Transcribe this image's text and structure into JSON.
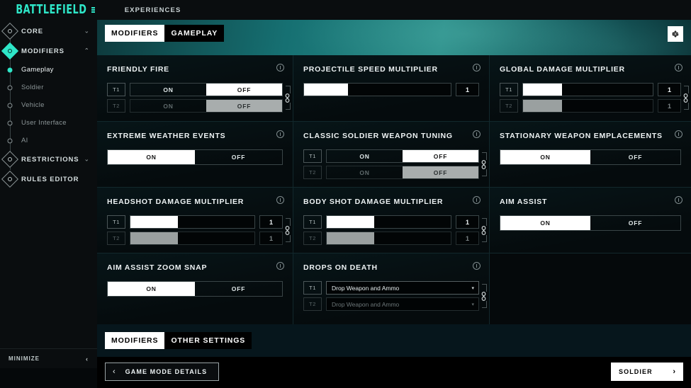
{
  "topbar": {
    "logo": "BATTLEFIELD",
    "nav": [
      {
        "label": "EXPERIENCES"
      }
    ]
  },
  "sidebar": {
    "items": [
      {
        "label": "CORE",
        "type": "section",
        "node": "diamond",
        "chevron": "⌄",
        "active": false
      },
      {
        "label": "MODIFIERS",
        "type": "section",
        "node": "diamond-filled",
        "chevron": "⌃",
        "active": true
      },
      {
        "label": "Gameplay",
        "type": "sub",
        "node": "dot-filled",
        "active": true
      },
      {
        "label": "Soldier",
        "type": "sub",
        "node": "dot",
        "active": false
      },
      {
        "label": "Vehicle",
        "type": "sub",
        "node": "dot",
        "active": false
      },
      {
        "label": "User Interface",
        "type": "sub",
        "node": "dot",
        "active": false
      },
      {
        "label": "AI",
        "type": "sub",
        "node": "dot",
        "active": false
      },
      {
        "label": "RESTRICTIONS",
        "type": "section",
        "node": "diamond",
        "chevron": "⌄",
        "active": false
      },
      {
        "label": "RULES EDITOR",
        "type": "section",
        "node": "diamond",
        "chevron": "",
        "active": false
      }
    ],
    "minimize_label": "MINIMIZE",
    "minimize_chevron": "‹"
  },
  "header": {
    "tabs": [
      {
        "label": "MODIFIERS",
        "active": true
      },
      {
        "label": "GAMEPLAY",
        "active": false
      }
    ],
    "gear_icon": "gear-icon",
    "accent_color": "#2ee6c8"
  },
  "cards": [
    {
      "title": "FRIENDLY FIRE",
      "control": "toggle-pair",
      "rows": [
        {
          "tier": "T1",
          "options": [
            "ON",
            "OFF"
          ],
          "selected": "OFF",
          "dim": false
        },
        {
          "tier": "T2",
          "options": [
            "ON",
            "OFF"
          ],
          "selected": "OFF",
          "dim": true
        }
      ],
      "linked": true
    },
    {
      "title": "PROJECTILE SPEED MULTIPLIER",
      "control": "slider-single",
      "rows": [
        {
          "value": "1",
          "fill_pct": 30,
          "dim": false
        }
      ],
      "linked": false
    },
    {
      "title": "GLOBAL DAMAGE MULTIPLIER",
      "control": "slider-pair",
      "rows": [
        {
          "tier": "T1",
          "value": "1",
          "fill_pct": 30,
          "dim": false
        },
        {
          "tier": "T2",
          "value": "1",
          "fill_pct": 30,
          "dim": true
        }
      ],
      "linked": true
    },
    {
      "title": "EXTREME WEATHER EVENTS",
      "control": "toggle-single",
      "rows": [
        {
          "options": [
            "ON",
            "OFF"
          ],
          "selected": "ON",
          "dim": false
        }
      ],
      "linked": false
    },
    {
      "title": "CLASSIC SOLDIER WEAPON TUNING",
      "control": "toggle-pair",
      "rows": [
        {
          "tier": "T1",
          "options": [
            "ON",
            "OFF"
          ],
          "selected": "OFF",
          "dim": false
        },
        {
          "tier": "T2",
          "options": [
            "ON",
            "OFF"
          ],
          "selected": "OFF",
          "dim": true
        }
      ],
      "linked": true
    },
    {
      "title": "STATIONARY WEAPON EMPLACEMENTS",
      "control": "toggle-single",
      "rows": [
        {
          "options": [
            "ON",
            "OFF"
          ],
          "selected": "ON",
          "dim": false
        }
      ],
      "linked": false
    },
    {
      "title": "HEADSHOT DAMAGE MULTIPLIER",
      "control": "slider-pair",
      "rows": [
        {
          "tier": "T1",
          "value": "1",
          "fill_pct": 38,
          "dim": false
        },
        {
          "tier": "T2",
          "value": "1",
          "fill_pct": 38,
          "dim": true
        }
      ],
      "linked": true
    },
    {
      "title": "BODY SHOT DAMAGE MULTIPLIER",
      "control": "slider-pair",
      "rows": [
        {
          "tier": "T1",
          "value": "1",
          "fill_pct": 38,
          "dim": false
        },
        {
          "tier": "T2",
          "value": "1",
          "fill_pct": 38,
          "dim": true
        }
      ],
      "linked": true
    },
    {
      "title": "AIM ASSIST",
      "control": "toggle-single",
      "rows": [
        {
          "options": [
            "ON",
            "OFF"
          ],
          "selected": "ON",
          "dim": false
        }
      ],
      "linked": false
    },
    {
      "title": "AIM ASSIST ZOOM SNAP",
      "control": "toggle-single",
      "rows": [
        {
          "options": [
            "ON",
            "OFF"
          ],
          "selected": "ON",
          "dim": false
        }
      ],
      "linked": false
    },
    {
      "title": "DROPS ON DEATH",
      "control": "select-pair",
      "rows": [
        {
          "tier": "T1",
          "value": "Drop Weapon and Ammo",
          "dim": false
        },
        {
          "tier": "T2",
          "value": "Drop Weapon and Ammo",
          "dim": true
        }
      ],
      "linked": true
    }
  ],
  "bottom_tabs": [
    {
      "label": "MODIFIERS",
      "active": true
    },
    {
      "label": "OTHER SETTINGS",
      "active": false
    }
  ],
  "footer": {
    "back_label": "GAME MODE DETAILS",
    "back_chevron": "‹",
    "next_label": "SOLDIER",
    "next_chevron": "›"
  }
}
